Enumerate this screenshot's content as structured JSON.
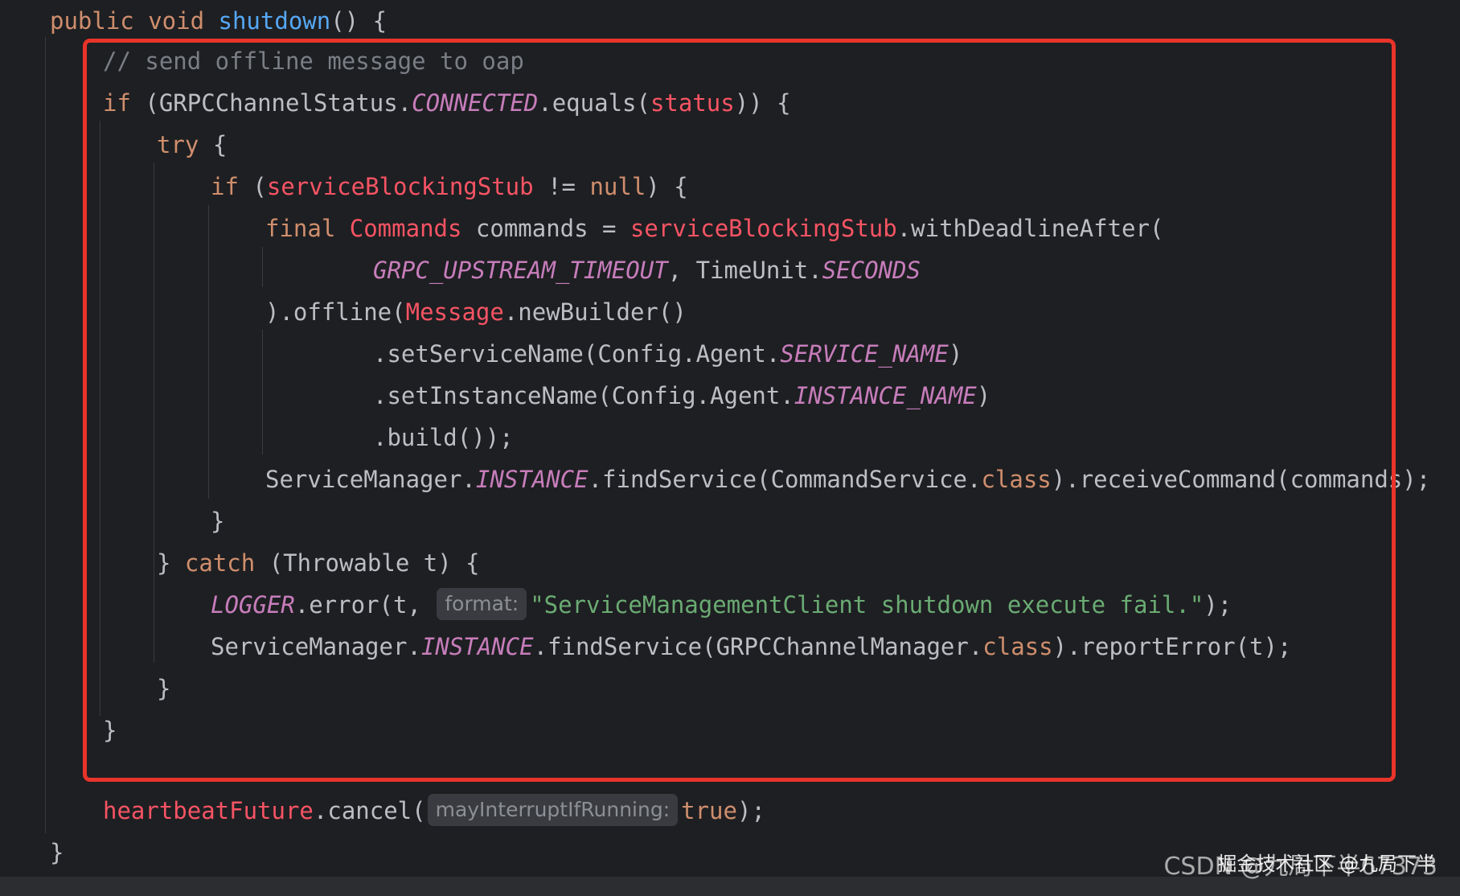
{
  "editor": {
    "lines": [
      {
        "tokens": [
          {
            "t": "public void ",
            "c": "kw"
          },
          {
            "t": "shutdown",
            "c": "fn"
          },
          {
            "t": "() {",
            "c": "plain"
          }
        ]
      },
      {
        "tokens": [
          {
            "t": "// send offline message to oap",
            "c": "cmt"
          }
        ]
      },
      {
        "tokens": [
          {
            "t": "if ",
            "c": "kw"
          },
          {
            "t": "(GRPCChannelStatus.",
            "c": "plain"
          },
          {
            "t": "CONNECTED",
            "c": "const"
          },
          {
            "t": ".equals(",
            "c": "plain"
          },
          {
            "t": "status",
            "c": "field"
          },
          {
            "t": ")) {",
            "c": "plain"
          }
        ]
      },
      {
        "tokens": [
          {
            "t": "try ",
            "c": "kw"
          },
          {
            "t": "{",
            "c": "plain"
          }
        ]
      },
      {
        "tokens": [
          {
            "t": "if ",
            "c": "kw"
          },
          {
            "t": "(",
            "c": "plain"
          },
          {
            "t": "serviceBlockingStub",
            "c": "field"
          },
          {
            "t": " != ",
            "c": "plain"
          },
          {
            "t": "null",
            "c": "kw"
          },
          {
            "t": ") {",
            "c": "plain"
          }
        ]
      },
      {
        "tokens": [
          {
            "t": "final ",
            "c": "kw"
          },
          {
            "t": "Commands",
            "c": "field"
          },
          {
            "t": " commands = ",
            "c": "plain"
          },
          {
            "t": "serviceBlockingStub",
            "c": "field"
          },
          {
            "t": ".withDeadlineAfter(",
            "c": "plain"
          }
        ]
      },
      {
        "tokens": [
          {
            "t": "GRPC_UPSTREAM_TIMEOUT",
            "c": "const"
          },
          {
            "t": ", TimeUnit.",
            "c": "plain"
          },
          {
            "t": "SECONDS",
            "c": "const"
          }
        ]
      },
      {
        "tokens": [
          {
            "t": ").offline(",
            "c": "plain"
          },
          {
            "t": "Message",
            "c": "field"
          },
          {
            "t": ".newBuilder()",
            "c": "plain"
          }
        ]
      },
      {
        "tokens": [
          {
            "t": ".setServiceName(Config.Agent.",
            "c": "plain"
          },
          {
            "t": "SERVICE_NAME",
            "c": "const"
          },
          {
            "t": ")",
            "c": "plain"
          }
        ]
      },
      {
        "tokens": [
          {
            "t": ".setInstanceName(Config.Agent.",
            "c": "plain"
          },
          {
            "t": "INSTANCE_NAME",
            "c": "const"
          },
          {
            "t": ")",
            "c": "plain"
          }
        ]
      },
      {
        "tokens": [
          {
            "t": ".build());",
            "c": "plain"
          }
        ]
      },
      {
        "tokens": [
          {
            "t": "ServiceManager.",
            "c": "plain"
          },
          {
            "t": "INSTANCE",
            "c": "const"
          },
          {
            "t": ".findService(CommandService.",
            "c": "plain"
          },
          {
            "t": "class",
            "c": "kw"
          },
          {
            "t": ").receiveCommand(commands);",
            "c": "plain"
          }
        ]
      },
      {
        "tokens": [
          {
            "t": "}",
            "c": "plain"
          }
        ]
      },
      {
        "tokens": [
          {
            "t": "} ",
            "c": "plain"
          },
          {
            "t": "catch ",
            "c": "kw"
          },
          {
            "t": "(Throwable t) {",
            "c": "plain"
          }
        ]
      },
      {
        "tokens": [
          {
            "t": "LOGGER",
            "c": "const"
          },
          {
            "t": ".error(t, ",
            "c": "plain"
          },
          {
            "t": "format:",
            "c": "hint"
          },
          {
            "t": "\"ServiceManagementClient shutdown execute fail.\"",
            "c": "str"
          },
          {
            "t": ");",
            "c": "plain"
          }
        ]
      },
      {
        "tokens": [
          {
            "t": "ServiceManager.",
            "c": "plain"
          },
          {
            "t": "INSTANCE",
            "c": "const"
          },
          {
            "t": ".findService(GRPCChannelManager.",
            "c": "plain"
          },
          {
            "t": "class",
            "c": "kw"
          },
          {
            "t": ").reportError(t);",
            "c": "plain"
          }
        ]
      },
      {
        "tokens": [
          {
            "t": "}",
            "c": "plain"
          }
        ]
      },
      {
        "tokens": [
          {
            "t": "}",
            "c": "plain"
          }
        ]
      },
      {
        "tokens": [
          {
            "t": "heartbeatFuture",
            "c": "field"
          },
          {
            "t": ".cancel(",
            "c": "plain"
          },
          {
            "t": "mayInterruptIfRunning:",
            "c": "hint"
          },
          {
            "t": "true",
            "c": "kw"
          },
          {
            "t": ");",
            "c": "plain"
          }
        ]
      },
      {
        "tokens": [
          {
            "t": "}",
            "c": "plain"
          }
        ]
      }
    ]
  },
  "watermark": {
    "csdn": "CSDN @九局下半67373",
    "juejin": "掘金技术社区 @九局下半"
  },
  "colors": {
    "background": "#1e1f22",
    "highlight_border": "#e8342a",
    "keyword": "#cf8e6d",
    "function": "#56a8f5",
    "comment": "#7a7e85",
    "constant": "#c77dbb",
    "field": "#f75464",
    "string": "#6aab73",
    "text": "#bcbec4"
  }
}
